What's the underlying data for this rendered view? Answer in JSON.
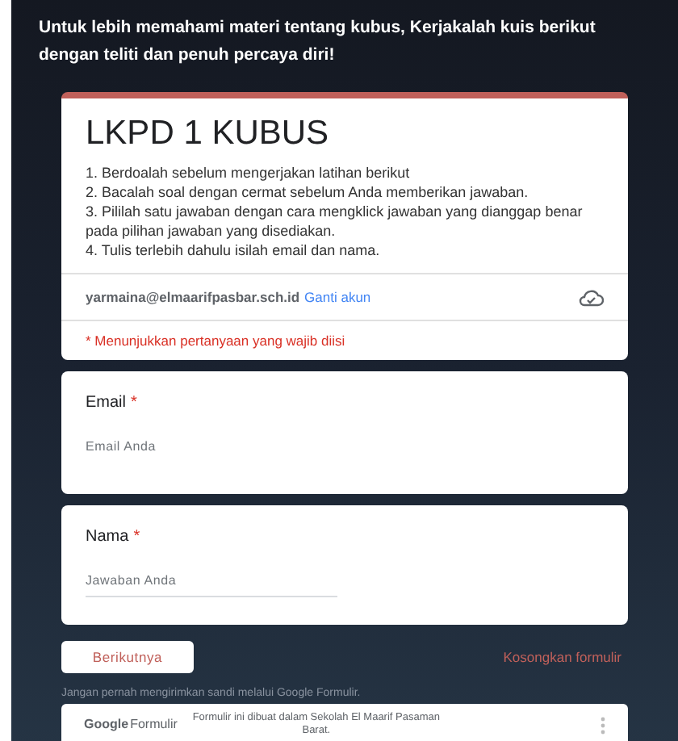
{
  "banner": "Untuk lebih memahami materi tentang kubus, Kerjakalah kuis berikut dengan teliti dan penuh percaya diri!",
  "form": {
    "title": "LKPD 1 KUBUS",
    "instructions": [
      "1. Berdoalah sebelum mengerjakan latihan berikut",
      "2. Bacalah soal dengan cermat sebelum Anda memberikan jawaban.",
      "3. Pililah satu jawaban dengan cara mengklick jawaban yang dianggap benar pada pilihan jawaban yang disediakan.",
      "4. Tulis terlebih dahulu isilah email dan nama."
    ],
    "account": "yarmaina@elmaarifpasbar.sch.id",
    "switch_account": "Ganti akun",
    "required_note": "* Menunjukkan pertanyaan yang wajib diisi"
  },
  "questions": [
    {
      "label": "Email",
      "required_mark": "*",
      "placeholder": "Email Anda",
      "kind": "plain"
    },
    {
      "label": "Nama",
      "required_mark": "*",
      "placeholder": "Jawaban Anda",
      "kind": "underline"
    }
  ],
  "next_button": "Berikutnya",
  "clear_link": "Kosongkan formulir",
  "warning": "Jangan pernah mengirimkan sandi melalui Google Formulir.",
  "footer": {
    "logo_google": "Google",
    "logo_forms": "Formulir",
    "note": "Formulir ini dibuat dalam Sekolah El Maarif Pasaman Barat."
  }
}
